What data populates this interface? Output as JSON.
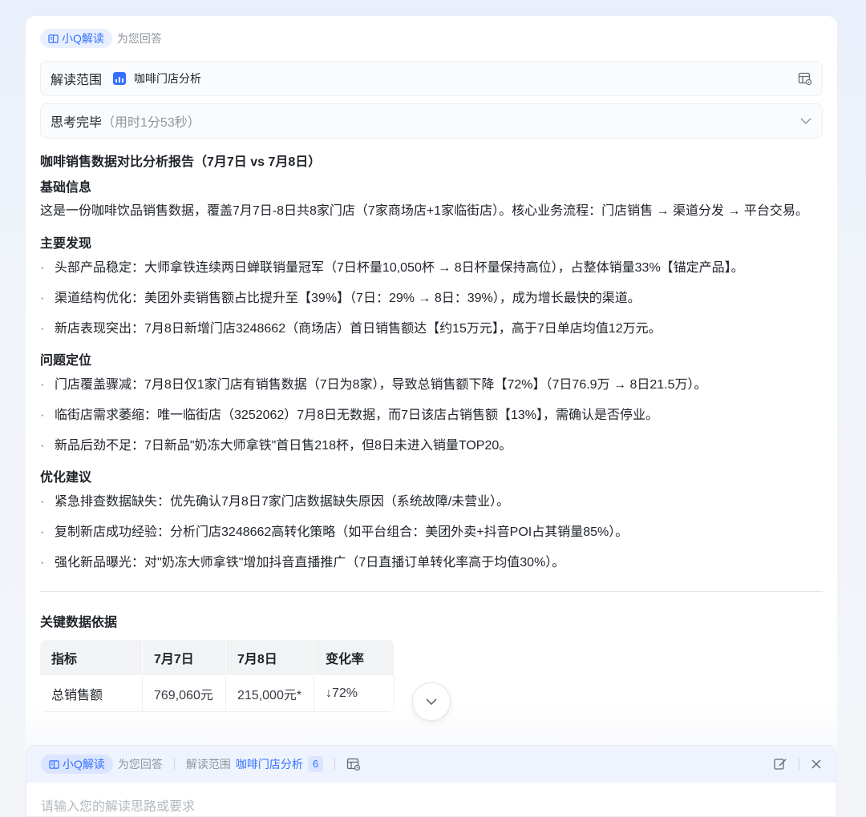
{
  "header": {
    "tag": "小Q解读",
    "sub": "为您回答"
  },
  "scope": {
    "label": "解读范围",
    "name": "咖啡门店分析"
  },
  "thinking": {
    "label": "思考完毕",
    "duration": "（用时1分53秒）"
  },
  "report": {
    "title": "咖啡销售数据对比分析报告（7月7日 vs 7月8日）",
    "basic": {
      "heading": "基础信息",
      "text": "这是一份咖啡饮品销售数据，覆盖7月7日-8日共8家门店（7家商场店+1家临街店）。核心业务流程：门店销售 → 渠道分发 → 平台交易。"
    },
    "findings": {
      "heading": "主要发现",
      "items": [
        {
          "key": "头部产品稳定",
          "text": "：大师拿铁连续两日蝉联销量冠军（7日杯量10,050杯 → 8日杯量保持高位），占整体销量33%【锚定产品】。"
        },
        {
          "key": "渠道结构优化",
          "text": "：美团外卖销售额占比提升至【39%】（7日：29% → 8日：39%），成为增长最快的渠道。"
        },
        {
          "key": "新店表现突出",
          "text": "：7月8日新增门店3248662（商场店）首日销售额达【约15万元】，高于7日单店均值12万元。"
        }
      ]
    },
    "problems": {
      "heading": "问题定位",
      "items": [
        {
          "key": "门店覆盖骤减",
          "text": "：7月8日仅1家门店有销售数据（7日为8家），导致总销售额下降【72%】（7日76.9万 → 8日21.5万）。"
        },
        {
          "key": "临街店需求萎缩",
          "text": "：唯一临街店（3252062）7月8日无数据，而7日该店占销售额【13%】，需确认是否停业。"
        },
        {
          "key": "新品后劲不足",
          "text": "：7日新品\"奶冻大师拿铁\"首日售218杯，但8日未进入销量TOP20。"
        }
      ]
    },
    "suggestions": {
      "heading": "优化建议",
      "items": [
        {
          "key": "紧急排查数据缺失",
          "text": "：优先确认7月8日7家门店数据缺失原因（系统故障/未营业）。"
        },
        {
          "key": "复制新店成功经验",
          "text": "：分析门店3248662高转化策略（如平台组合：美团外卖+抖音POI占其销量85%）。"
        },
        {
          "key": "强化新品曝光",
          "text": "：对\"奶冻大师拿铁\"增加抖音直播推广（7日直播订单转化率高于均值30%）。"
        }
      ]
    },
    "evidence": {
      "heading": "关键数据依据",
      "columns": [
        "指标",
        "7月7日",
        "7月8日",
        "变化率"
      ],
      "rows": [
        [
          "总销售额",
          "769,060元",
          "215,000元*",
          "↓72%"
        ]
      ]
    }
  },
  "composer": {
    "tag": "小Q解读",
    "sub": "为您回答",
    "scope_label": "解读范围",
    "scope_name": "咖啡门店分析",
    "count": "6",
    "placeholder": "请输入您的解读思路或要求"
  },
  "colors": {
    "accent": "#3370ff",
    "tag_bg": "#e8efff"
  }
}
